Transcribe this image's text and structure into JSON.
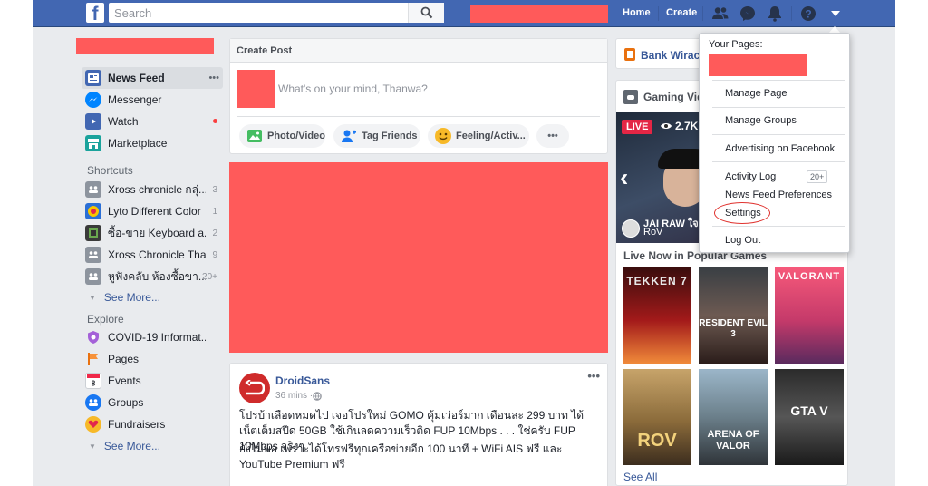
{
  "topbar": {
    "logo": "f",
    "search_placeholder": "Search",
    "home": "Home",
    "create": "Create"
  },
  "sidebar": {
    "items": [
      {
        "label": "News Feed",
        "more": "•••"
      },
      {
        "label": "Messenger"
      },
      {
        "label": "Watch"
      },
      {
        "label": "Marketplace"
      }
    ],
    "shortcuts_title": "Shortcuts",
    "shortcuts": [
      {
        "label": "Xross chronicle กลุ่...",
        "count": "3"
      },
      {
        "label": "Lyto Different Color",
        "count": "1"
      },
      {
        "label": "ซื้อ-ขาย Keyboard a...",
        "count": "2"
      },
      {
        "label": "Xross Chronicle Thai",
        "count": "9"
      },
      {
        "label": "หูฟังคลับ ห้องซื้อขา...",
        "count": "20+"
      }
    ],
    "see_more": "See More...",
    "explore_title": "Explore",
    "explore": [
      {
        "label": "COVID-19 Informat..."
      },
      {
        "label": "Pages"
      },
      {
        "label": "Events"
      },
      {
        "label": "Groups"
      },
      {
        "label": "Fundraisers"
      }
    ],
    "see_more_2": "See More..."
  },
  "create_post": {
    "title": "Create Post",
    "placeholder": "What's on your mind, Thanwa?",
    "photo_video": "Photo/Video",
    "tag_friends": "Tag Friends",
    "feeling": "Feeling/Activ...",
    "more": "•••"
  },
  "post": {
    "author": "DroidSans",
    "time": "36 mins · ",
    "more": "•••",
    "text1": "โปรบ้าเลือดหมดไป เจอโปรใหม่ GOMO คุ้มเว่อร์มาก เดือนละ 299 บาท ได้เน็ตเต็มสปีด 50GB ใช้เกินลดความเร็วติด FUP 10Mbps . . . ใช่ครับ FUP 10Mbps จริงๆ",
    "text2": "ยังไม่พอ เพราะได้โทรฟรีทุกเครือข่ายอีก 100 นาที + WiFi AIS ฟรี และ YouTube Premium ฟรี"
  },
  "right": {
    "page_name": "Bank Wirach",
    "gaming_title": "Gaming Vide",
    "live_badge": "LIVE",
    "viewers": "2.7K",
    "streamer_name": "JAI RAW ใจ",
    "streamer_game": "RoV",
    "live_now_title": "Live Now in Popular Games",
    "games": [
      {
        "name": "TEKKEN 7"
      },
      {
        "name": "RESIDENT EVIL 3"
      },
      {
        "name": "VALORANT"
      },
      {
        "name": "ROV"
      },
      {
        "name": "ARENA OF VALOR"
      },
      {
        "name": "GTA V"
      }
    ],
    "see_all": "See All"
  },
  "dropdown": {
    "your_pages": "Your Pages:",
    "manage_page": "Manage Page",
    "manage_groups": "Manage Groups",
    "advertising": "Advertising on Facebook",
    "activity_log": "Activity Log",
    "activity_badge": "20+",
    "news_feed_prefs": "News Feed Preferences",
    "settings": "Settings",
    "log_out": "Log Out"
  },
  "colors": {
    "brand": "#4267b2",
    "redaction": "#ff5a5a",
    "link": "#385898",
    "highlight_circle": "#e0332f"
  }
}
